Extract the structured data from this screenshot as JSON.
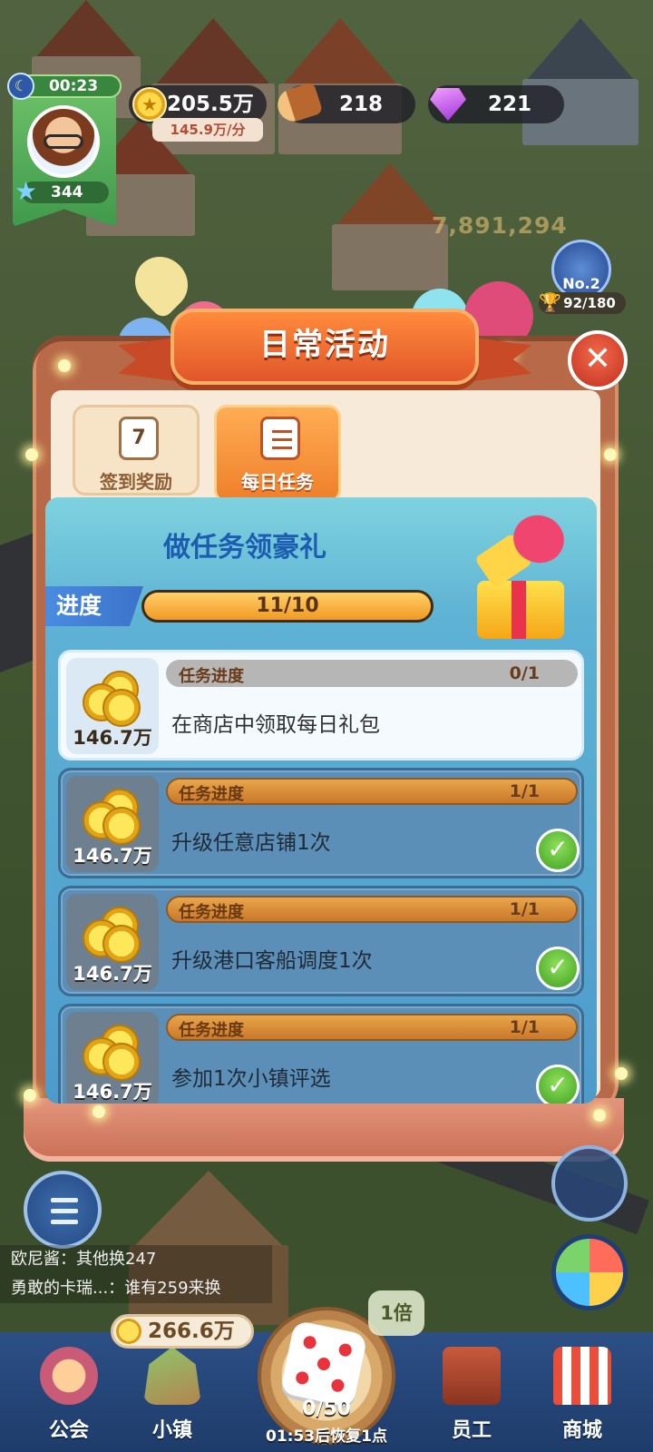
{
  "hud": {
    "timer": "00:23",
    "player_level": "344",
    "coins": "205.5万",
    "coin_rate": "145.9万/分",
    "wood": "218",
    "gems": "221",
    "background_score": "7,891,294",
    "rank": "No.2",
    "rank_progress": "92/180"
  },
  "modal": {
    "title": "日常活动",
    "tabs": [
      {
        "label": "签到奖励",
        "icon": "calendar-icon",
        "icon_text": "7",
        "active": false
      },
      {
        "label": "每日任务",
        "icon": "clipboard-icon",
        "active": true
      }
    ],
    "header_title": "做任务领豪礼",
    "progress_label": "进度",
    "progress_text": "11/10",
    "progress_fraction": 1.0,
    "tasks": [
      {
        "reward": "146.7万",
        "progress_label": "任务进度",
        "progress": "0/1",
        "description": "在商店中领取每日礼包",
        "completed": false
      },
      {
        "reward": "146.7万",
        "progress_label": "任务进度",
        "progress": "1/1",
        "description": "升级任意店铺1次",
        "completed": true
      },
      {
        "reward": "146.7万",
        "progress_label": "任务进度",
        "progress": "1/1",
        "description": "升级港口客船调度1次",
        "completed": true
      },
      {
        "reward": "146.7万",
        "progress_label": "任务进度",
        "progress": "1/1",
        "description": "参加1次小镇评选",
        "completed": true
      }
    ]
  },
  "chat": [
    "欧尼酱：其他换247",
    "勇敢的卡瑞...：谁有259来换"
  ],
  "bottom": {
    "town_coins": "266.6万",
    "multiplier": "1倍",
    "dice_count": "0/50",
    "dice_recover": "01:53后恢复1点",
    "nav": [
      {
        "label": "公会",
        "icon": "guild-icon"
      },
      {
        "label": "小镇",
        "icon": "town-icon"
      },
      {
        "label": "员工",
        "icon": "staff-book-icon"
      },
      {
        "label": "商城",
        "icon": "shop-icon"
      }
    ]
  },
  "colors": {
    "accent": "#ef7f2a",
    "title_ribbon": "#e2562a",
    "panel_blue": "#4d9bcb",
    "check_green": "#3ea022"
  }
}
